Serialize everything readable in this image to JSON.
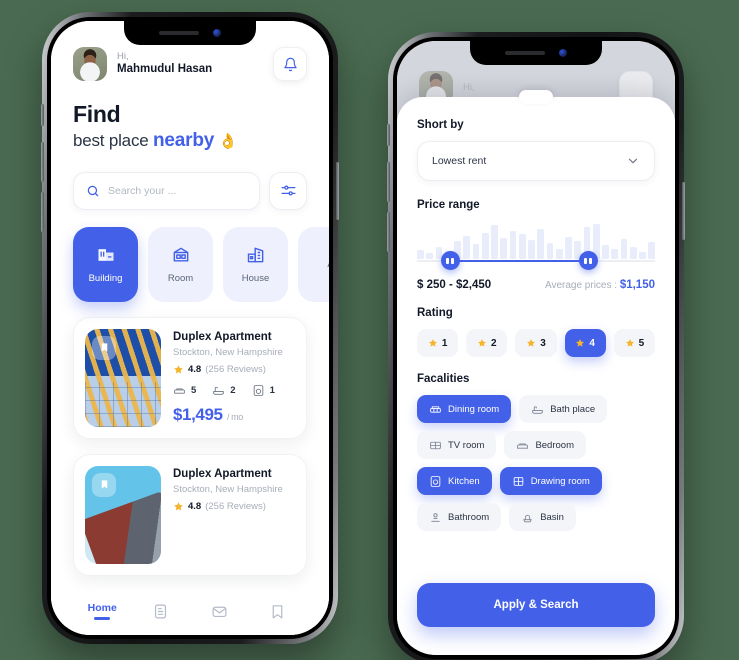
{
  "home": {
    "greeting": "Hi,",
    "user_name": "Mahmudul Hasan",
    "bell_icon": "bell-icon",
    "headline_line1": "Find",
    "headline_line2_plain": "best place ",
    "headline_line2_accent": "nearby",
    "headline_emoji": "👌",
    "search": {
      "placeholder": "Search your ...",
      "value": "",
      "icon": "search-icon"
    },
    "filter_icon": "sliders-icon",
    "categories": [
      {
        "label": "Building",
        "icon": "building-icon",
        "active": true
      },
      {
        "label": "Room",
        "icon": "room-icon",
        "active": false
      },
      {
        "label": "House",
        "icon": "house-icon",
        "active": false
      },
      {
        "label": "A",
        "icon": "apartment-icon",
        "active": false
      }
    ],
    "listings": [
      {
        "title": "Duplex Apartment",
        "address": "Stockton, New Hampshire",
        "rating": "4.8",
        "reviews": "(256 Reviews)",
        "beds": "5",
        "baths": "2",
        "laundry": "1",
        "price": "$1,495",
        "price_unit": "/ mo"
      },
      {
        "title": "Duplex Apartment",
        "address": "Stockton, New Hampshire",
        "rating": "4.8",
        "reviews": "(256 Reviews)"
      }
    ],
    "tabs": [
      {
        "label": "Home",
        "icon": "home-icon",
        "active": true
      },
      {
        "label": "",
        "icon": "document-icon",
        "active": false
      },
      {
        "label": "",
        "icon": "envelope-icon",
        "active": false
      },
      {
        "label": "",
        "icon": "bookmark-icon",
        "active": false
      }
    ]
  },
  "filter": {
    "sort": {
      "title": "Short by",
      "value": "Lowest rent",
      "chevron_icon": "chevron-down-icon"
    },
    "price": {
      "title": "Price range",
      "range_label": "$ 250 - $2,450",
      "average_label": "Average prices : ",
      "average_value": "$1,150",
      "histogram": [
        22,
        14,
        30,
        20,
        44,
        58,
        38,
        66,
        84,
        52,
        70,
        62,
        48,
        74,
        40,
        26,
        56,
        46,
        80,
        88,
        34,
        24,
        50,
        30,
        18,
        42
      ],
      "handle_left_pct": 14,
      "handle_right_pct": 72
    },
    "rating": {
      "title": "Rating",
      "options": [
        {
          "label": "1",
          "active": false
        },
        {
          "label": "2",
          "active": false
        },
        {
          "label": "3",
          "active": false
        },
        {
          "label": "4",
          "active": true
        },
        {
          "label": "5",
          "active": false
        }
      ]
    },
    "facilities": {
      "title": "Facalities",
      "options": [
        {
          "label": "Dining room",
          "icon": "sofa-icon",
          "active": true
        },
        {
          "label": "Bath place",
          "icon": "bathtub-icon",
          "active": false
        },
        {
          "label": "TV room",
          "icon": "tv-icon",
          "active": false
        },
        {
          "label": "Bedroom",
          "icon": "bed-icon",
          "active": false
        },
        {
          "label": "Kitchen",
          "icon": "kitchen-icon",
          "active": true
        },
        {
          "label": "Drawing room",
          "icon": "drawing-room-icon",
          "active": true
        },
        {
          "label": "Bathroom",
          "icon": "shower-icon",
          "active": false
        },
        {
          "label": "Basin",
          "icon": "basin-icon",
          "active": false
        }
      ]
    },
    "apply_label": "Apply & Search",
    "background": {
      "greeting": "Hi,"
    }
  },
  "colors": {
    "primary": "#4361e8",
    "star": "#f5b42b",
    "page_background": "#4a6b51",
    "text_dark": "#111827",
    "text_muted": "#a7adb9"
  }
}
